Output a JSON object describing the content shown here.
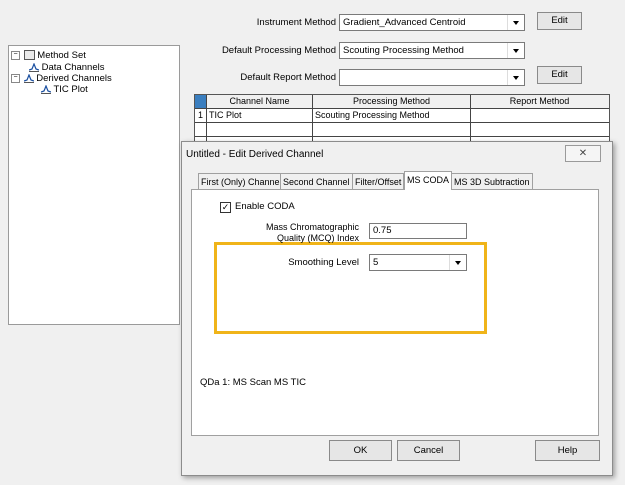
{
  "method_form": {
    "instrument_method_label": "Instrument Method",
    "instrument_method_value": "Gradient_Advanced Centroid",
    "default_processing_method_label": "Default Processing Method",
    "default_processing_method_value": "Scouting Processing Method",
    "default_report_method_label": "Default Report Method",
    "default_report_method_value": "",
    "edit_label": "Edit"
  },
  "tree": {
    "root": "Method Set",
    "items": [
      "Data Channels",
      "Derived Channels",
      "TIC Plot"
    ]
  },
  "grid": {
    "columns": [
      "Channel Name",
      "Processing Method",
      "Report Method"
    ],
    "rows": [
      {
        "num": "1",
        "channel": "TIC Plot",
        "processing": "Scouting Processing Method",
        "report": ""
      }
    ]
  },
  "dialog": {
    "title": "Untitled - Edit Derived Channel",
    "tabs": [
      "First (Only) Channel",
      "Second Channel",
      "Filter/Offset",
      "MS CODA",
      "MS 3D Subtraction"
    ],
    "active_tab": "MS CODA",
    "enable_coda_label": "Enable CODA",
    "enable_coda_checked": true,
    "mcq_label_line1": "Mass Chromatographic",
    "mcq_label_line2": "Quality (MCQ) Index",
    "mcq_value": "0.75",
    "smoothing_label": "Smoothing Level",
    "smoothing_value": "5",
    "source_text": "QDa 1: MS Scan MS TIC",
    "ok_label": "OK",
    "cancel_label": "Cancel",
    "help_label": "Help",
    "close_glyph": "✕",
    "highlight_color": "#f0b419"
  }
}
